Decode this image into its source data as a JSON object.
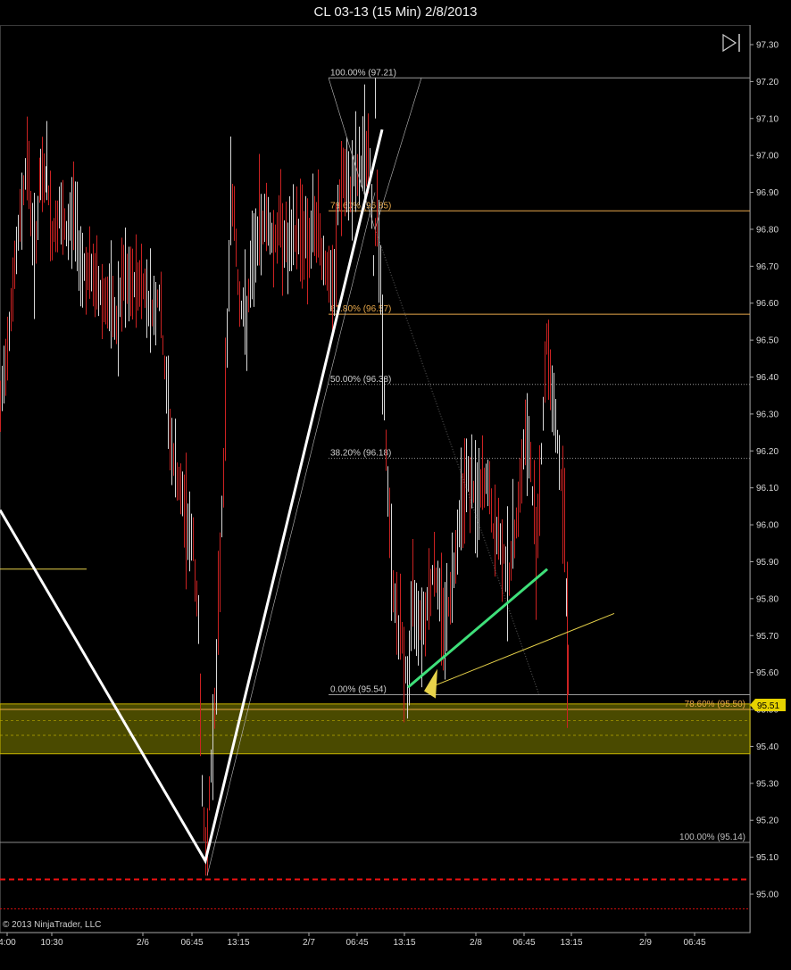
{
  "title": "CL 03-13 (15 Min)  2/8/2013",
  "copyright": "© 2013 NinjaTrader, LLC",
  "price_marker": "95.51",
  "colors": {
    "background": "#000000",
    "zone_fill": "#4a4a00",
    "zone_border": "#c8b400",
    "up_wick": "#d8d8d8",
    "down_wick": "#cc2222",
    "white_line": "#ffffff",
    "green_line": "#3fe07a",
    "yellow_line": "#e8d34a",
    "fib_orange": "#e8a84a",
    "red_dashed": "#ee1111"
  },
  "chart_data": {
    "type": "line",
    "ylim": [
      94.9,
      97.34
    ],
    "y_ticks": [
      "97.30",
      "97.20",
      "97.10",
      "97.00",
      "96.90",
      "96.80",
      "96.70",
      "96.60",
      "96.50",
      "96.40",
      "96.30",
      "96.20",
      "96.10",
      "96.00",
      "95.90",
      "95.80",
      "95.70",
      "95.60",
      "95.50",
      "95.40",
      "95.30",
      "95.20",
      "95.10",
      "95.00"
    ],
    "x_ticks": [
      "4:00",
      "10:30",
      "2/6",
      "06:45",
      "13:15",
      "2/7",
      "06:45",
      "13:15",
      "2/8",
      "06:45",
      "13:15",
      "2/9",
      "06:45"
    ],
    "price_path": [
      [
        0,
        96.3
      ],
      [
        10,
        96.55
      ],
      [
        20,
        96.78
      ],
      [
        30,
        97.0
      ],
      [
        38,
        96.72
      ],
      [
        45,
        96.93
      ],
      [
        52,
        96.95
      ],
      [
        58,
        96.78
      ],
      [
        66,
        96.84
      ],
      [
        74,
        96.78
      ],
      [
        82,
        96.86
      ],
      [
        90,
        96.72
      ],
      [
        98,
        96.68
      ],
      [
        106,
        96.66
      ],
      [
        114,
        96.62
      ],
      [
        122,
        96.6
      ],
      [
        130,
        96.54
      ],
      [
        138,
        96.66
      ],
      [
        146,
        96.64
      ],
      [
        154,
        96.66
      ],
      [
        162,
        96.64
      ],
      [
        170,
        96.58
      ],
      [
        178,
        96.62
      ],
      [
        184,
        96.42
      ],
      [
        192,
        96.2
      ],
      [
        200,
        96.1
      ],
      [
        208,
        96.02
      ],
      [
        216,
        95.94
      ],
      [
        222,
        95.72
      ],
      [
        226,
        95.3
      ],
      [
        230,
        95.08
      ],
      [
        234,
        95.26
      ],
      [
        238,
        95.44
      ],
      [
        242,
        95.58
      ],
      [
        246,
        95.9
      ],
      [
        250,
        96.15
      ],
      [
        254,
        96.5
      ],
      [
        258,
        96.9
      ],
      [
        262,
        96.84
      ],
      [
        266,
        96.66
      ],
      [
        270,
        96.58
      ],
      [
        276,
        96.56
      ],
      [
        282,
        96.7
      ],
      [
        290,
        96.8
      ],
      [
        298,
        96.84
      ],
      [
        306,
        96.76
      ],
      [
        314,
        96.82
      ],
      [
        322,
        96.74
      ],
      [
        330,
        96.78
      ],
      [
        338,
        96.8
      ],
      [
        346,
        96.76
      ],
      [
        354,
        96.82
      ],
      [
        362,
        96.72
      ],
      [
        370,
        96.64
      ],
      [
        374,
        96.62
      ],
      [
        378,
        96.86
      ],
      [
        384,
        96.94
      ],
      [
        390,
        96.88
      ],
      [
        396,
        96.96
      ],
      [
        402,
        96.94
      ],
      [
        408,
        97.02
      ],
      [
        414,
        96.98
      ],
      [
        418,
        96.7
      ],
      [
        422,
        96.9
      ],
      [
        428,
        96.5
      ],
      [
        432,
        96.18
      ],
      [
        436,
        96.0
      ],
      [
        440,
        95.82
      ],
      [
        446,
        95.72
      ],
      [
        450,
        95.68
      ],
      [
        456,
        95.56
      ],
      [
        462,
        95.8
      ],
      [
        468,
        95.76
      ],
      [
        474,
        95.74
      ],
      [
        480,
        95.82
      ],
      [
        486,
        95.88
      ],
      [
        492,
        95.8
      ],
      [
        498,
        95.74
      ],
      [
        504,
        95.8
      ],
      [
        510,
        95.94
      ],
      [
        516,
        96.06
      ],
      [
        522,
        96.14
      ],
      [
        528,
        96.1
      ],
      [
        534,
        96.06
      ],
      [
        540,
        96.1
      ],
      [
        546,
        96.12
      ],
      [
        552,
        95.98
      ],
      [
        558,
        95.96
      ],
      [
        564,
        95.92
      ],
      [
        570,
        95.86
      ],
      [
        576,
        95.98
      ],
      [
        582,
        96.1
      ],
      [
        588,
        96.24
      ],
      [
        594,
        96.16
      ],
      [
        600,
        95.94
      ],
      [
        606,
        96.2
      ],
      [
        612,
        96.5
      ],
      [
        618,
        96.36
      ],
      [
        624,
        96.22
      ],
      [
        628,
        96.12
      ],
      [
        632,
        96.0
      ],
      [
        636,
        95.62
      ],
      [
        638,
        95.48
      ]
    ],
    "fib_levels_upper": [
      {
        "label": "100.00% (97.21)",
        "value": 97.21
      },
      {
        "label": "78.60% (96.85)",
        "value": 96.85
      },
      {
        "label": "61.80% (96.57)",
        "value": 96.57
      },
      {
        "label": "50.00% (96.38)",
        "value": 96.38
      },
      {
        "label": "38.20% (96.18)",
        "value": 96.18
      },
      {
        "label": "0.00% (95.54)",
        "value": 95.54
      }
    ],
    "fib_levels_lower": [
      {
        "label": "78.60% (95.50)",
        "value": 95.5
      },
      {
        "label": "100.00% (95.14)",
        "value": 95.14
      }
    ],
    "red_dashed_level": 95.04,
    "red_thin_level": 94.96,
    "zone": {
      "top": 95.515,
      "bottom": 95.38,
      "inner": [
        95.47,
        95.43
      ]
    },
    "left_yellow_level": 95.88
  }
}
